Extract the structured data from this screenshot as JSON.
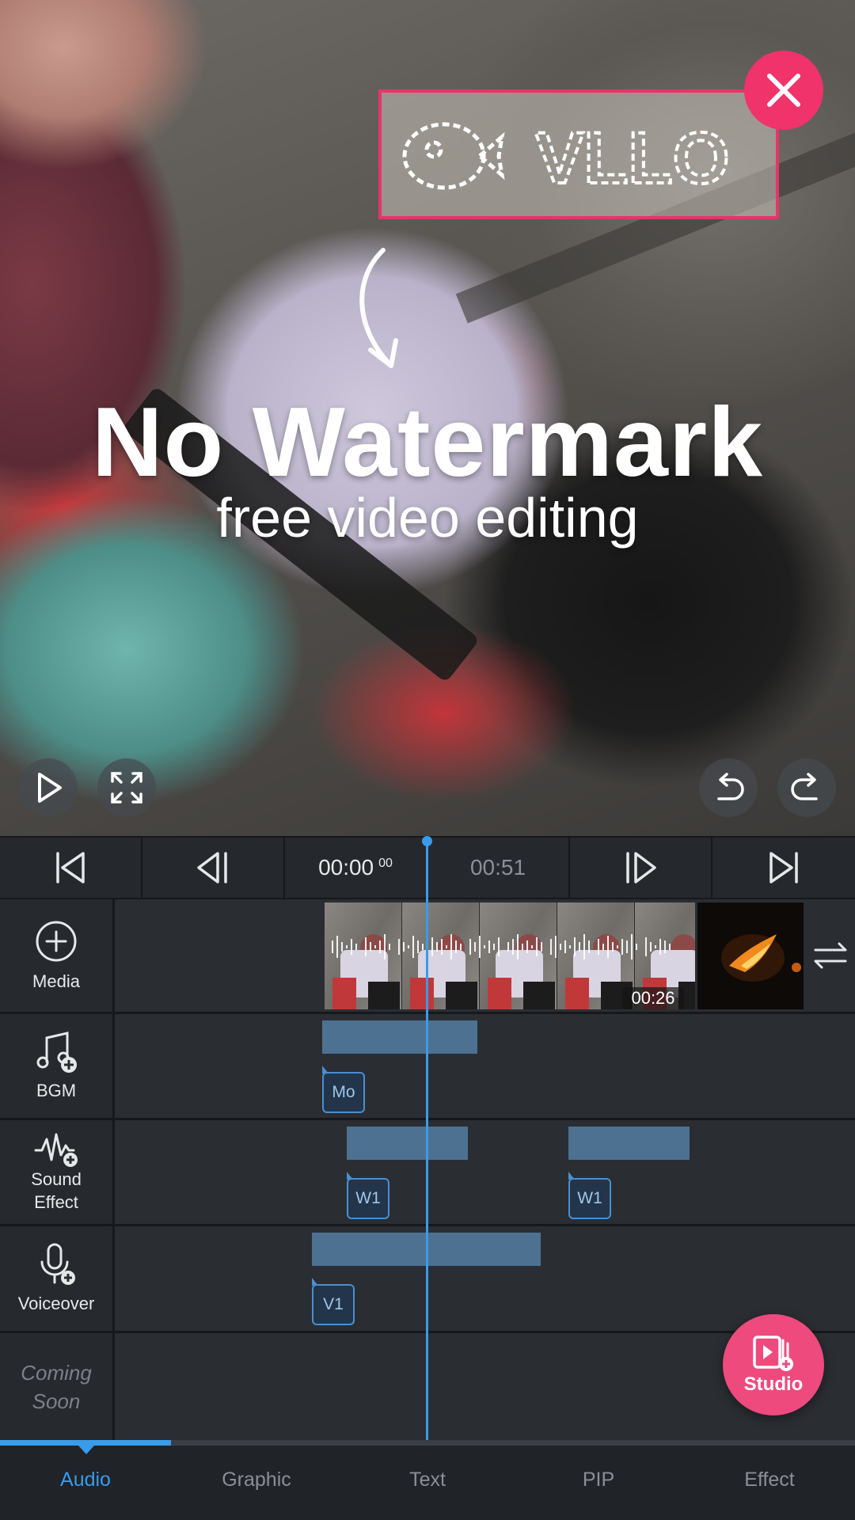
{
  "preview": {
    "watermark_text": "VLLO",
    "headline": "No Watermark",
    "subheadline": "free video editing"
  },
  "transport": {
    "current_time": "00:00",
    "current_frames": "00",
    "total_time": "00:51"
  },
  "tracks": {
    "media": {
      "label": "Media",
      "clip_duration": "00:26"
    },
    "bgm": {
      "label": "BGM",
      "clips": [
        "Mo"
      ]
    },
    "sound_effect": {
      "label": "Sound\nEffect",
      "label_line1": "Sound",
      "label_line2": "Effect",
      "clips": [
        "W1",
        "W1"
      ]
    },
    "voiceover": {
      "label": "Voiceover",
      "clips": [
        "V1"
      ]
    },
    "coming_soon": {
      "label_line1": "Coming",
      "label_line2": "Soon"
    }
  },
  "studio_button": {
    "label": "Studio"
  },
  "tabs": [
    {
      "label": "Audio",
      "active": true
    },
    {
      "label": "Graphic",
      "active": false
    },
    {
      "label": "Text",
      "active": false
    },
    {
      "label": "PIP",
      "active": false
    },
    {
      "label": "Effect",
      "active": false
    }
  ],
  "colors": {
    "accent": "#3a9bea",
    "close": "#f0336a",
    "studio": "#ee4a7e",
    "audio_clip": "#4d7191"
  }
}
